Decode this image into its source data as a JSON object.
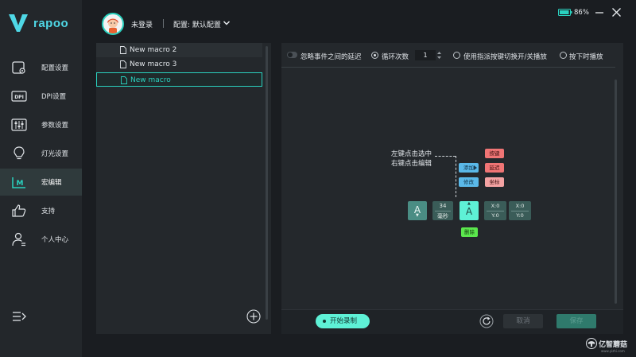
{
  "app": {
    "brand": "rapoo",
    "accent_color": "#2ad1bf"
  },
  "sidebar": {
    "items": [
      {
        "label": "配置设置",
        "icon": "config-gear-icon"
      },
      {
        "label": "DPI设置",
        "icon": "dpi-icon"
      },
      {
        "label": "参数设置",
        "icon": "sliders-icon"
      },
      {
        "label": "灯光设置",
        "icon": "lightbulb-icon"
      },
      {
        "label": "宏编辑",
        "icon": "macro-icon",
        "active": true
      },
      {
        "label": "支持",
        "icon": "thumbs-up-icon"
      },
      {
        "label": "个人中心",
        "icon": "user-icon"
      }
    ]
  },
  "header": {
    "login_status": "未登录",
    "config_label": "配置: 默认配置",
    "battery": "86%"
  },
  "macro_list": {
    "items": [
      {
        "label": "New macro 2"
      },
      {
        "label": "New macro 3"
      },
      {
        "label": "New macro",
        "selected": true
      }
    ]
  },
  "options": {
    "ignore_delay": "忽略事件之间的延迟",
    "loop_count": "循环次数",
    "loop_value": "1",
    "toggle_play": "使用指派按键切换开/关播放",
    "hold_play": "按下时播放"
  },
  "editor": {
    "hint_line1": "左键点击选中",
    "hint_line2": "右键点击编辑",
    "blocks": {
      "key_down": "A",
      "delay_value": "34",
      "delay_unit": "毫秒",
      "key_up": "A",
      "coord1_x": "X:0",
      "coord1_y": "Y:0",
      "coord2_x": "X:0",
      "coord2_y": "Y:0"
    },
    "context_menu": {
      "add": "添加",
      "edit": "修改",
      "key": "按键",
      "delay": "延迟",
      "coord": "坐标",
      "delete": "删除"
    }
  },
  "bottom": {
    "record": "开始录制",
    "cancel": "取消",
    "save": "保存"
  },
  "watermark": {
    "text": "亿智蘑菇",
    "sub": "www.yizhi.com"
  }
}
